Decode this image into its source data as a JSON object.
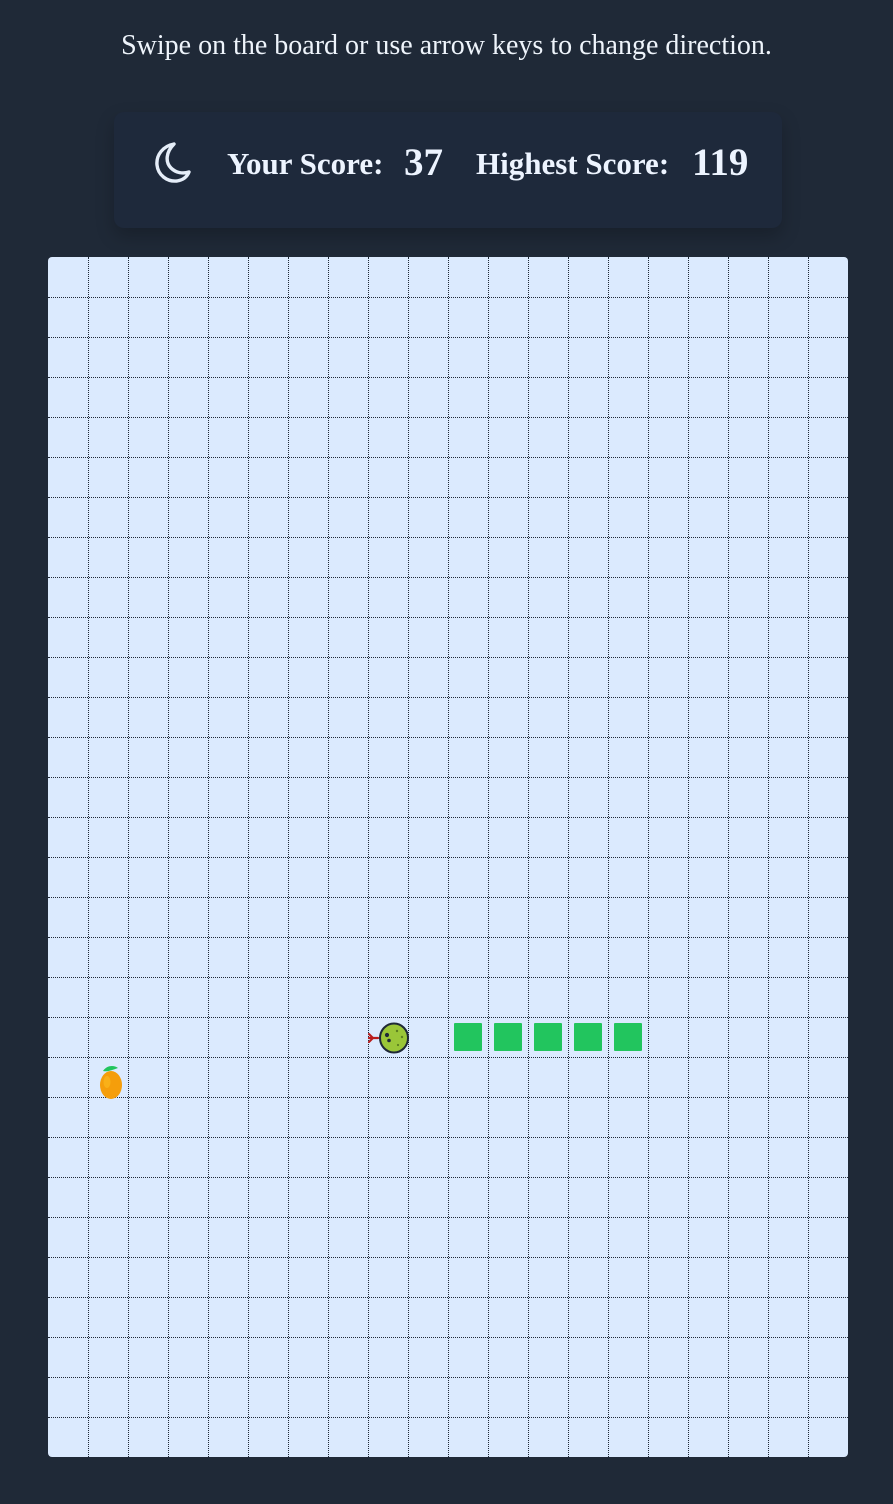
{
  "instructions": "Swipe on the board or use arrow keys to change direction.",
  "header": {
    "theme_icon": "moon-icon",
    "your_score_label": "Your Score:",
    "your_score_value": "37",
    "highest_score_label": "Highest Score:",
    "highest_score_value": "119"
  },
  "board": {
    "columns": 20,
    "rows": 30,
    "background_color": "#dbeafe",
    "grid_color": "#1f2937",
    "snake_color": "#22c55e",
    "snake_head_color": "#9ac638",
    "food_color": "#f59e0b",
    "snake": {
      "direction": "left",
      "head": {
        "col": 9,
        "row": 19
      },
      "body": [
        {
          "col": 10,
          "row": 19
        },
        {
          "col": 11,
          "row": 19
        },
        {
          "col": 12,
          "row": 19
        },
        {
          "col": 13,
          "row": 19
        },
        {
          "col": 14,
          "row": 19
        }
      ]
    },
    "food": {
      "type": "mango",
      "col": 1,
      "row": 20
    }
  }
}
